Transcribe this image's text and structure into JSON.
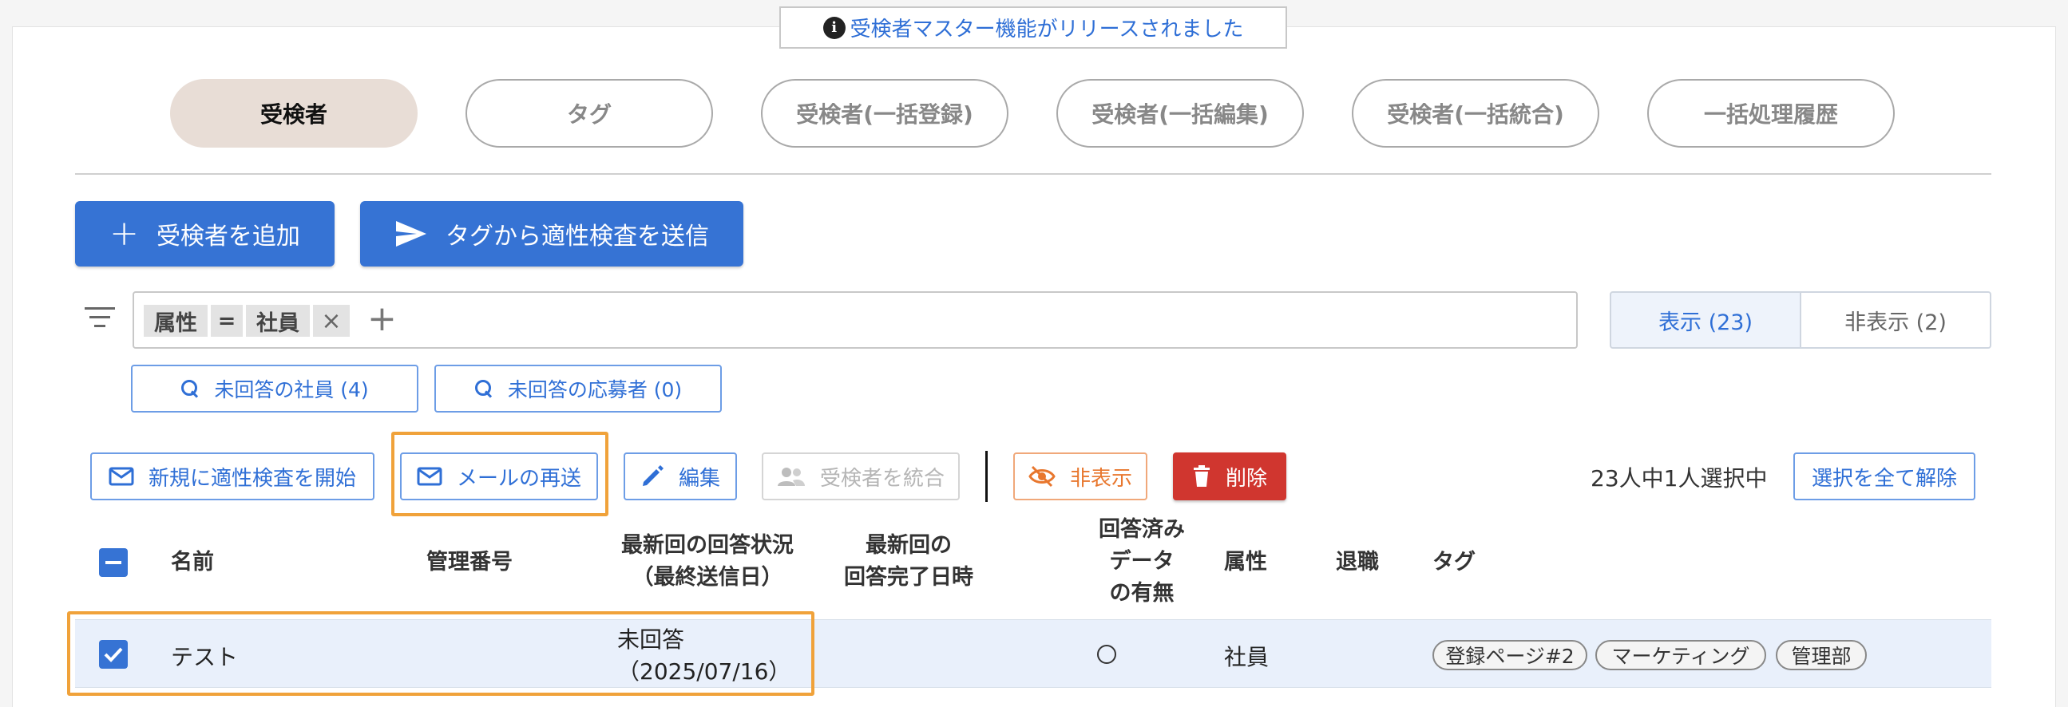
{
  "notice": {
    "text": "受検者マスター機能がリリースされました"
  },
  "tabs": [
    {
      "label": "受検者"
    },
    {
      "label": "タグ"
    },
    {
      "label": "受検者(一括登録)"
    },
    {
      "label": "受検者(一括編集)"
    },
    {
      "label": "受検者(一括統合)"
    },
    {
      "label": "一括処理履歴"
    }
  ],
  "primary_actions": {
    "add_label": "受検者を追加",
    "send_label": "タグから適性検査を送信"
  },
  "filter": {
    "field": "属性",
    "operator": "=",
    "value": "社員",
    "remove": "×",
    "add": "+"
  },
  "visibility": {
    "shown": "表示 (23)",
    "hidden": "非表示 (2)"
  },
  "quick_filters": [
    {
      "label": "未回答の社員 (4)"
    },
    {
      "label": "未回答の応募者 (0)"
    }
  ],
  "row_actions": {
    "start": "新規に適性検査を開始",
    "resend": "メールの再送",
    "edit": "編集",
    "merge": "受検者を統合",
    "hide": "非表示",
    "delete": "削除"
  },
  "selection": {
    "count": "23人中1人選択中",
    "clear": "選択を全て解除"
  },
  "table": {
    "headers": {
      "name": "名前",
      "mgmt_no": "管理番号",
      "status_line1": "最新回の回答状況",
      "status_line2": "（最終送信日）",
      "completed_line1": "最新回の",
      "completed_line2": "回答完了日時",
      "answered_line1": "回答済み",
      "answered_line2": "データ",
      "answered_line3": "の有無",
      "attribute": "属性",
      "retired": "退職",
      "tags": "タグ"
    },
    "rows": [
      {
        "name": "テスト",
        "mgmt_no": "",
        "status": "未回答",
        "sent_date": "（2025/07/16）",
        "completed": "",
        "answered": "○",
        "attribute": "社員",
        "retired": "",
        "tags": [
          "登録ページ#2",
          "マーケティング",
          "管理部"
        ]
      }
    ]
  },
  "colors": {
    "primary": "#3673d4",
    "danger": "#d0362f",
    "warn": "#e8772e",
    "highlight": "#f0a23a",
    "active_tab": "#e8ddd6"
  }
}
